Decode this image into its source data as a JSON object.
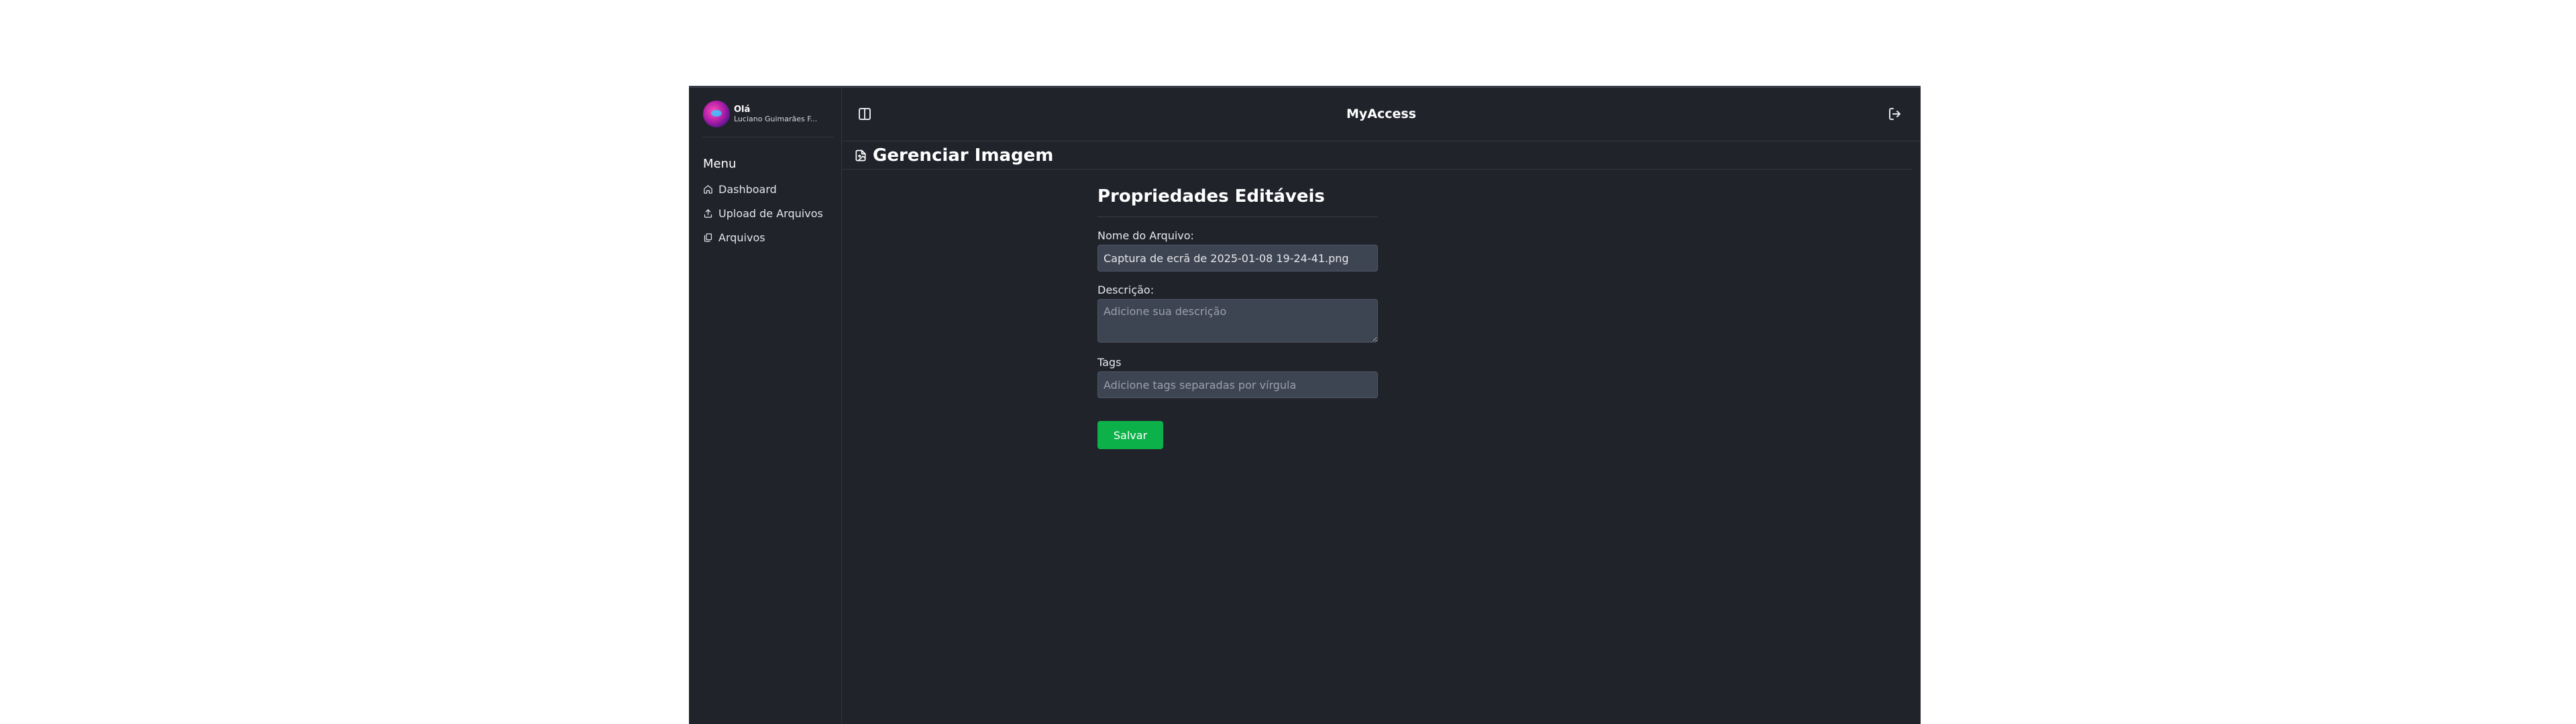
{
  "app": {
    "title": "MyAccess"
  },
  "user": {
    "greeting": "Olá",
    "name": "Luciano Guimarães F..."
  },
  "sidebar": {
    "menu_title": "Menu",
    "items": [
      {
        "label": "Dashboard",
        "icon": "home-icon"
      },
      {
        "label": "Upload de Arquivos",
        "icon": "upload-icon"
      },
      {
        "label": "Arquivos",
        "icon": "files-icon"
      }
    ]
  },
  "header": {
    "toggle_icon": "panel-toggle-icon",
    "logout_icon": "logout-icon"
  },
  "page": {
    "title": "Gerenciar Imagem",
    "title_icon": "image-file-icon"
  },
  "form": {
    "title": "Propriedades Editáveis",
    "file_name_label": "Nome do Arquivo:",
    "file_name_value": "Captura de ecrã de 2025-01-08 19-24-41.png",
    "description_label": "Descrição:",
    "description_placeholder": "Adicione sua descrição",
    "tags_label": "Tags",
    "tags_placeholder": "Adicione tags separadas por vírgula",
    "save_label": "Salvar"
  },
  "colors": {
    "background": "#21232b",
    "input_background": "#3e4552",
    "save_button": "#0db14a"
  }
}
